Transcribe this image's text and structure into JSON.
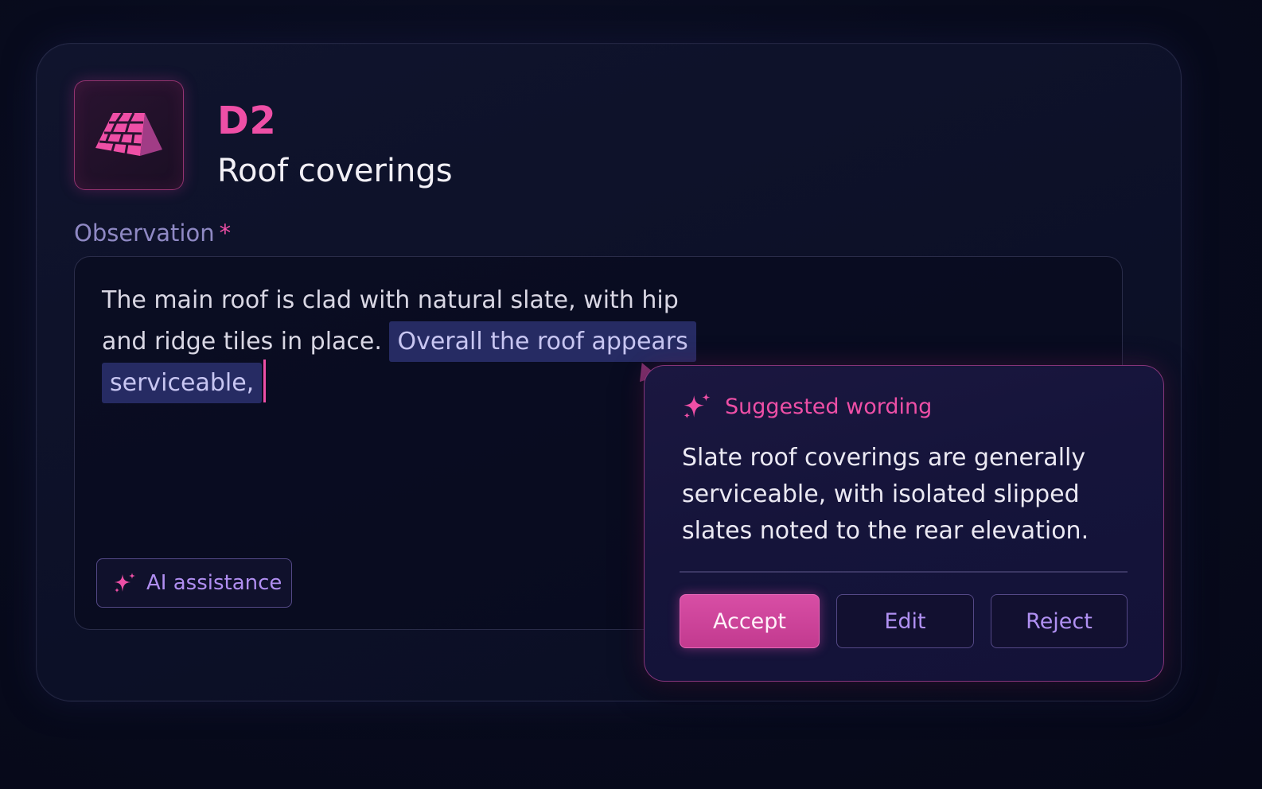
{
  "section": {
    "code": "D2",
    "title": "Roof coverings",
    "icon": "roof-tiles-icon"
  },
  "observation": {
    "label": "Observation",
    "required_marker": "*",
    "text_plain": "The main roof is clad with natural slate, with hip and ridge tiles in place.",
    "text_selected": "Overall the roof appears serviceable,"
  },
  "ai_button": {
    "label": "AI assistance",
    "icon": "sparkle-icon"
  },
  "suggestion": {
    "title": "Suggested wording",
    "icon": "sparkle-icon",
    "body": "Slate roof coverings are generally serviceable, with isolated slipped slates noted to the rear elevation.",
    "actions": {
      "accept": "Accept",
      "edit": "Edit",
      "reject": "Reject"
    }
  },
  "colors": {
    "accent_pink": "#ee4fa6",
    "accent_purple": "#b090f2",
    "background": "#080b1d",
    "selection": "#262b63"
  }
}
